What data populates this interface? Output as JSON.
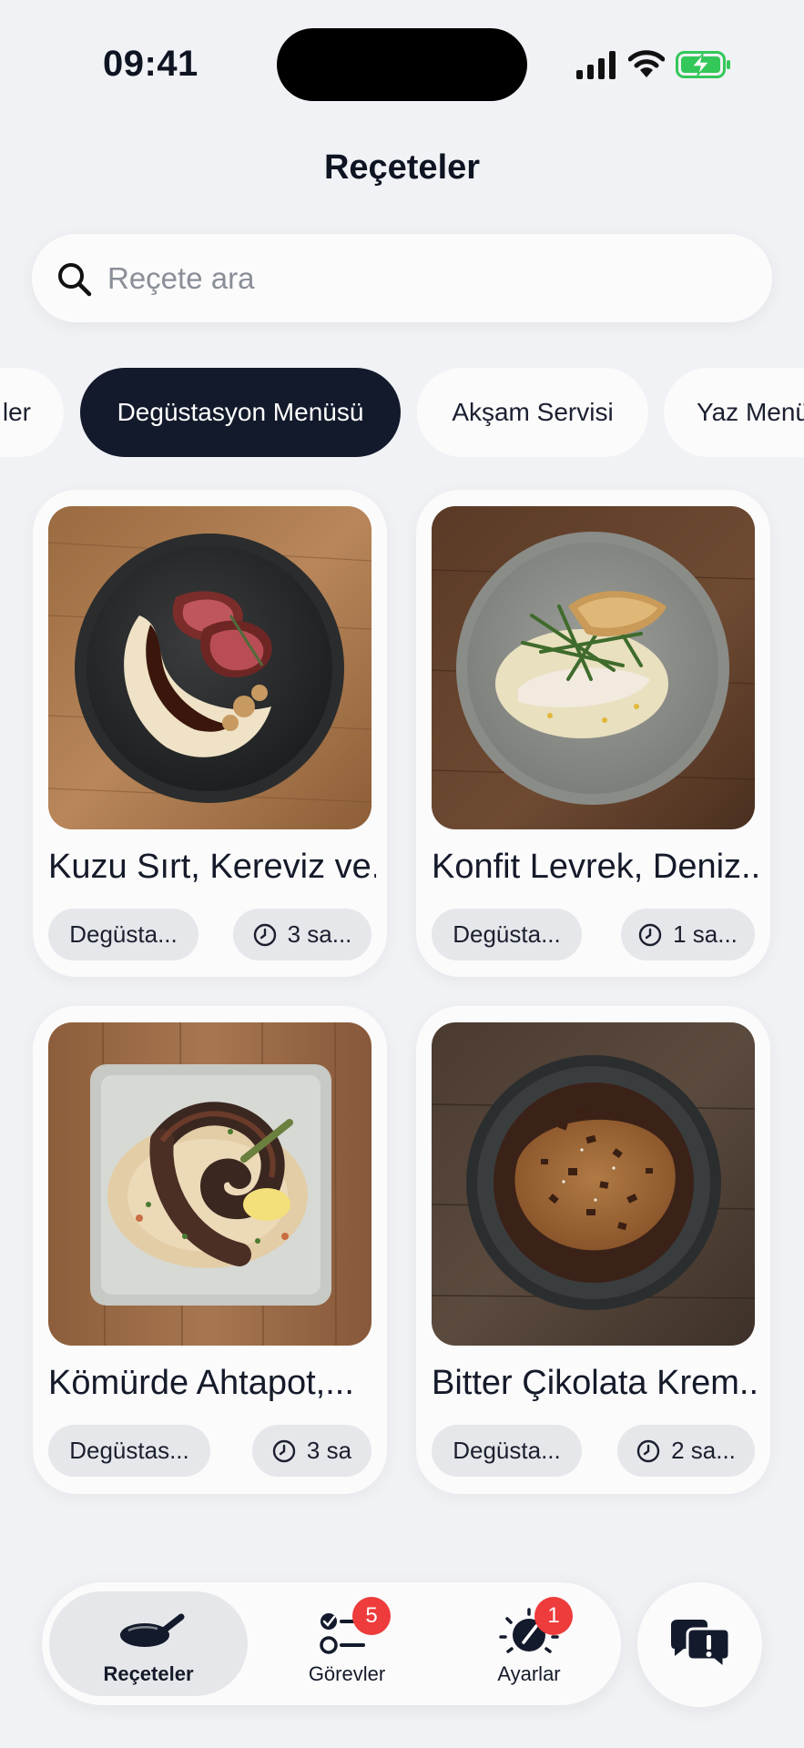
{
  "status_bar": {
    "time": "09:41"
  },
  "header": {
    "title": "Reçeteler"
  },
  "search": {
    "placeholder": "Reçete ara"
  },
  "filters": [
    {
      "label": "ler",
      "active": false
    },
    {
      "label": "Degüstasyon Menüsü",
      "active": true
    },
    {
      "label": "Akşam Servisi",
      "active": false
    },
    {
      "label": "Yaz Menü",
      "active": false
    }
  ],
  "recipes": [
    {
      "title": "Kuzu Sırt, Kereviz ve...",
      "category": "Degüsta...",
      "duration": "3 sa...",
      "image": "lamb-loin-celeriac-plate"
    },
    {
      "title": "Konfit Levrek, Deniz...",
      "category": "Degüsta...",
      "duration": "1 sa...",
      "image": "confit-sea-bass-plate"
    },
    {
      "title": "Kömürde Ahtapot,...",
      "category": "Degüstas...",
      "duration": "3 sa",
      "image": "charred-octopus-plate"
    },
    {
      "title": "Bitter Çikolata Krem...",
      "category": "Degüsta...",
      "duration": "2 sa...",
      "image": "dark-chocolate-cream-bowl"
    }
  ],
  "tabbar": {
    "tabs": [
      {
        "label": "Reçeteler",
        "icon": "pan-icon",
        "active": true
      },
      {
        "label": "Görevler",
        "icon": "tasks-icon",
        "badge": "5"
      },
      {
        "label": "Ayarlar",
        "icon": "gauge-icon",
        "badge": "1"
      }
    ],
    "chat_icon": "chat-alert-icon"
  },
  "colors": {
    "accent": "#131a2b",
    "badge": "#ee3b3b",
    "background": "#f1f2f5",
    "battery": "#34c759"
  }
}
